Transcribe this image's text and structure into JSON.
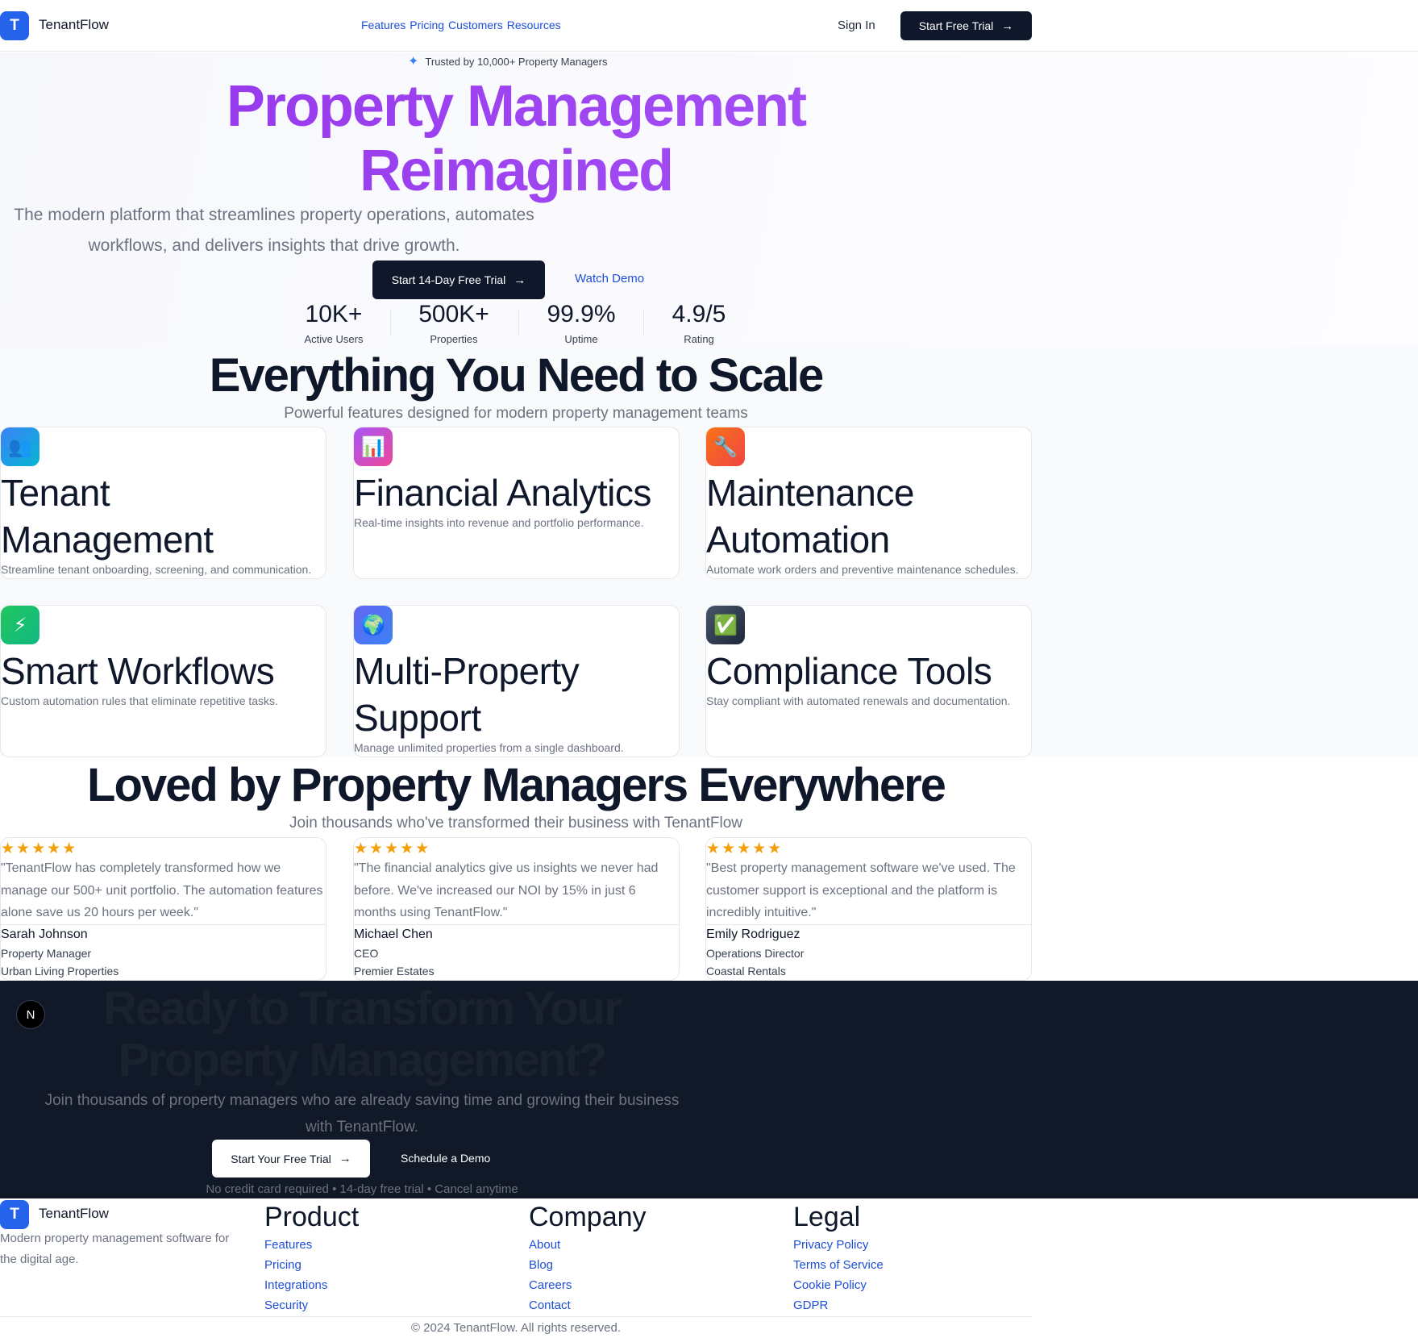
{
  "header": {
    "logo_letter": "T",
    "brand": "TenantFlow",
    "nav": [
      "Features",
      "Pricing",
      "Customers",
      "Resources"
    ],
    "sign_in": "Sign In",
    "cta": "Start Free Trial"
  },
  "hero": {
    "badge": "Trusted by 10,000+ Property Managers",
    "title_line1": "Property Management",
    "title_line2": "Reimagined",
    "sub_line1": "The modern platform that streamlines property operations, automates",
    "sub_line2": "workflows, and delivers insights that drive growth.",
    "primary_cta": "Start 14-Day Free Trial",
    "secondary_cta": "Watch Demo",
    "stats": [
      {
        "value": "10K+",
        "label": "Active Users"
      },
      {
        "value": "500K+",
        "label": "Properties"
      },
      {
        "value": "99.9%",
        "label": "Uptime"
      },
      {
        "value": "4.9/5",
        "label": "Rating"
      }
    ]
  },
  "features": {
    "title": "Everything You Need to Scale",
    "subtitle": "Powerful features designed for modern property management teams",
    "items": [
      {
        "icon": "👥",
        "title": "Tenant Management",
        "desc": "Streamline tenant onboarding, screening, and communication."
      },
      {
        "icon": "📊",
        "title": "Financial Analytics",
        "desc": "Real-time insights into revenue and portfolio performance."
      },
      {
        "icon": "🔧",
        "title": "Maintenance Automation",
        "desc": "Automate work orders and preventive maintenance schedules."
      },
      {
        "icon": "⚡",
        "title": "Smart Workflows",
        "desc": "Custom automation rules that eliminate repetitive tasks."
      },
      {
        "icon": "🌍",
        "title": "Multi-Property Support",
        "desc": "Manage unlimited properties from a single dashboard."
      },
      {
        "icon": "✅",
        "title": "Compliance Tools",
        "desc": "Stay compliant with automated renewals and documentation."
      }
    ]
  },
  "testimonials": {
    "title": "Loved by Property Managers Everywhere",
    "subtitle": "Join thousands who've transformed their business with TenantFlow",
    "stars": "★★★★★",
    "items": [
      {
        "quote": "\"TenantFlow has completely transformed how we manage our 500+ unit portfolio. The automation features alone save us 20 hours per week.\"",
        "name": "Sarah Johnson",
        "role": "Property Manager",
        "company": "Urban Living Properties"
      },
      {
        "quote": "\"The financial analytics give us insights we never had before. We've increased our NOI by 15% in just 6 months using TenantFlow.\"",
        "name": "Michael Chen",
        "role": "CEO",
        "company": "Premier Estates"
      },
      {
        "quote": "\"Best property management software we've used. The customer support is exceptional and the platform is incredibly intuitive.\"",
        "name": "Emily Rodriguez",
        "role": "Operations Director",
        "company": "Coastal Rentals"
      }
    ]
  },
  "cta": {
    "badge": "N",
    "title_line1": "Ready to Transform Your",
    "title_line2": "Property Management?",
    "sub_line1": "Join thousands of property managers who are already saving time and growing their business",
    "sub_line2": "with TenantFlow.",
    "primary": "Start Your Free Trial",
    "secondary": "Schedule a Demo",
    "note": "No credit card required • 14-day free trial • Cancel anytime"
  },
  "footer": {
    "logo_letter": "T",
    "brand": "TenantFlow",
    "tagline": "Modern property management software for the digital age.",
    "columns": [
      {
        "heading": "Product",
        "links": [
          "Features",
          "Pricing",
          "Integrations",
          "Security"
        ]
      },
      {
        "heading": "Company",
        "links": [
          "About",
          "Blog",
          "Careers",
          "Contact"
        ]
      },
      {
        "heading": "Legal",
        "links": [
          "Privacy Policy",
          "Terms of Service",
          "Cookie Policy",
          "GDPR"
        ]
      }
    ],
    "copyright": "© 2024 TenantFlow. All rights reserved."
  },
  "colors": {
    "brand_blue": "#2563eb",
    "hero_purple": "#9333ea",
    "dark_navy": "#111827",
    "star_gold": "#f59e0b"
  }
}
